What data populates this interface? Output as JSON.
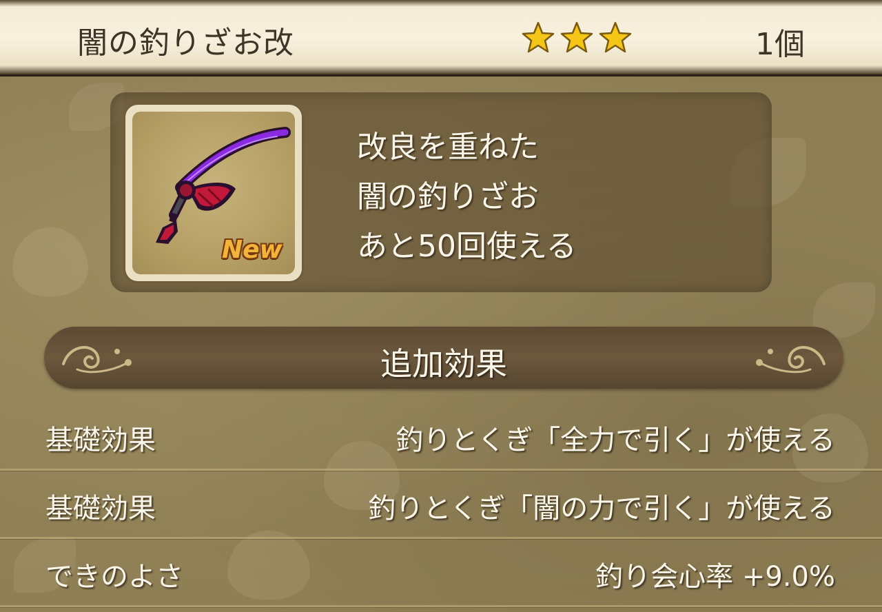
{
  "header": {
    "item_name": "闇の釣りざお改",
    "rarity_stars": 3,
    "quantity": "1個"
  },
  "item": {
    "icon_name": "dark-fishing-rod-icon",
    "new_badge": "New",
    "description": [
      "改良を重ねた",
      "闇の釣りざお",
      "あと50回使える"
    ]
  },
  "section": {
    "title": "追加効果"
  },
  "effects": [
    {
      "label": "基礎効果",
      "value": "釣りとくぎ「全力で引く」が使える"
    },
    {
      "label": "基礎効果",
      "value": "釣りとくぎ「闇の力で引く」が使える"
    },
    {
      "label": "できのよさ",
      "value": "釣り会心率  +9.0%"
    }
  ],
  "colors": {
    "star": "#f5c518",
    "rod_purple": "#7a1fd6",
    "rod_red": "#c2183a",
    "text_light": "#fbf6ea",
    "text_dark": "#3e3428"
  }
}
